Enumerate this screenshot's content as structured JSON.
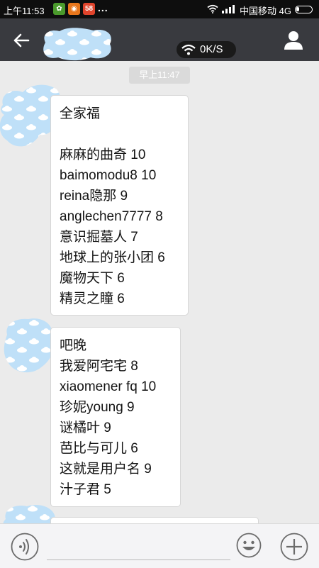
{
  "status_bar": {
    "time": "上午11:53",
    "notification_badge": "58",
    "more_dots": "...",
    "carrier": "中国移动 4G"
  },
  "header": {
    "network_speed": "0K/S"
  },
  "chat": {
    "timestamp": "早上11:47",
    "messages": [
      {
        "lines": [
          "全家福",
          "",
          "麻麻的曲奇 10",
          "baimomodu8 10",
          "reina隐那 9",
          "anglechen7777 8",
          "意识掘墓人 7",
          "地球上的张小团 6",
          "魔物天下 6",
          "精灵之瞳 6"
        ]
      },
      {
        "lines": [
          "吧晚",
          "我爱阿宅宅 8",
          "xiaomener fq 10",
          "珍妮young 9",
          "谜橘叶 9",
          "芭比与可儿 6",
          "这就是用户名 9",
          "汁子君 5"
        ]
      }
    ]
  },
  "colors": {
    "header_bg": "#393a3f",
    "chat_bg": "#ebebeb",
    "bubble_bg": "#ffffff",
    "blur_blue": "#bfe0f8"
  },
  "icons": [
    "back-arrow-icon",
    "profile-icon",
    "wifi-icon",
    "voice-icon",
    "emoji-icon",
    "plus-icon"
  ]
}
